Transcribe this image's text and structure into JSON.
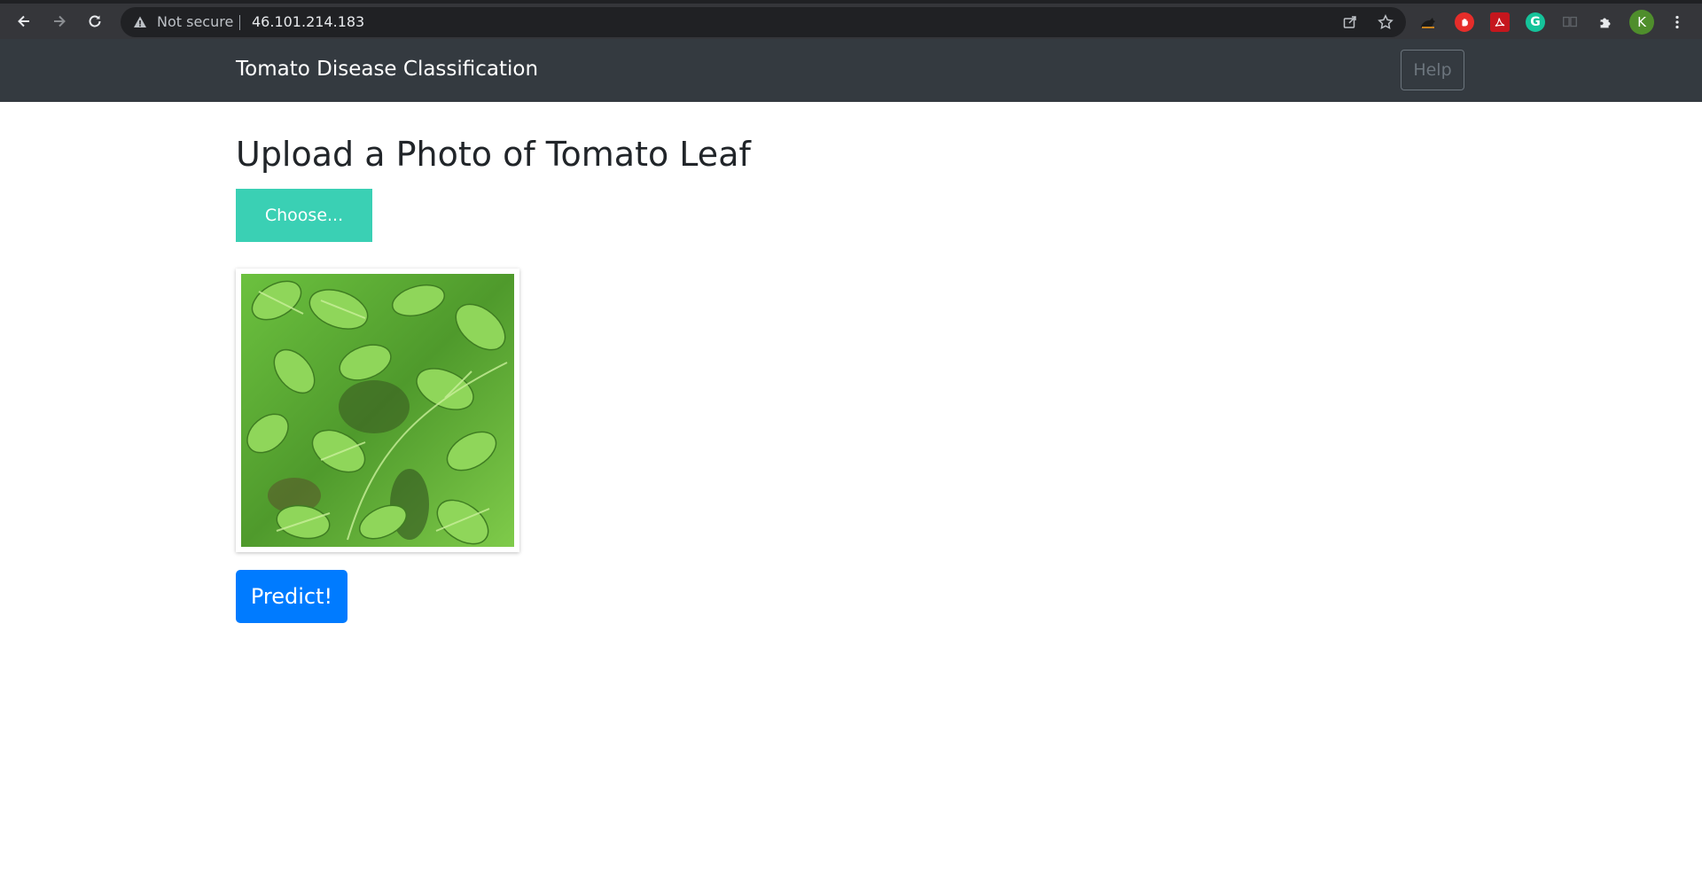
{
  "browser": {
    "security_label": "Not secure",
    "url": "46.101.214.183",
    "profile_initial": "K",
    "grammarly_letter": "G",
    "icons": [
      "back-arrow-icon",
      "forward-arrow-icon",
      "reload-icon",
      "warning-icon",
      "share-icon",
      "star-icon",
      "extension-icons",
      "puzzle-icon",
      "kebab-menu-icon"
    ]
  },
  "navbar": {
    "brand": "Tomato Disease Classification",
    "help_label": "Help"
  },
  "main": {
    "heading": "Upload a Photo of Tomato Leaf",
    "choose_label": "Choose...",
    "predict_label": "Predict!"
  },
  "colors": {
    "navbar_bg": "#343a40",
    "choose_button": "#3ad0b4",
    "predict_button": "#007bff",
    "leaf_green": "#6cc13f"
  }
}
